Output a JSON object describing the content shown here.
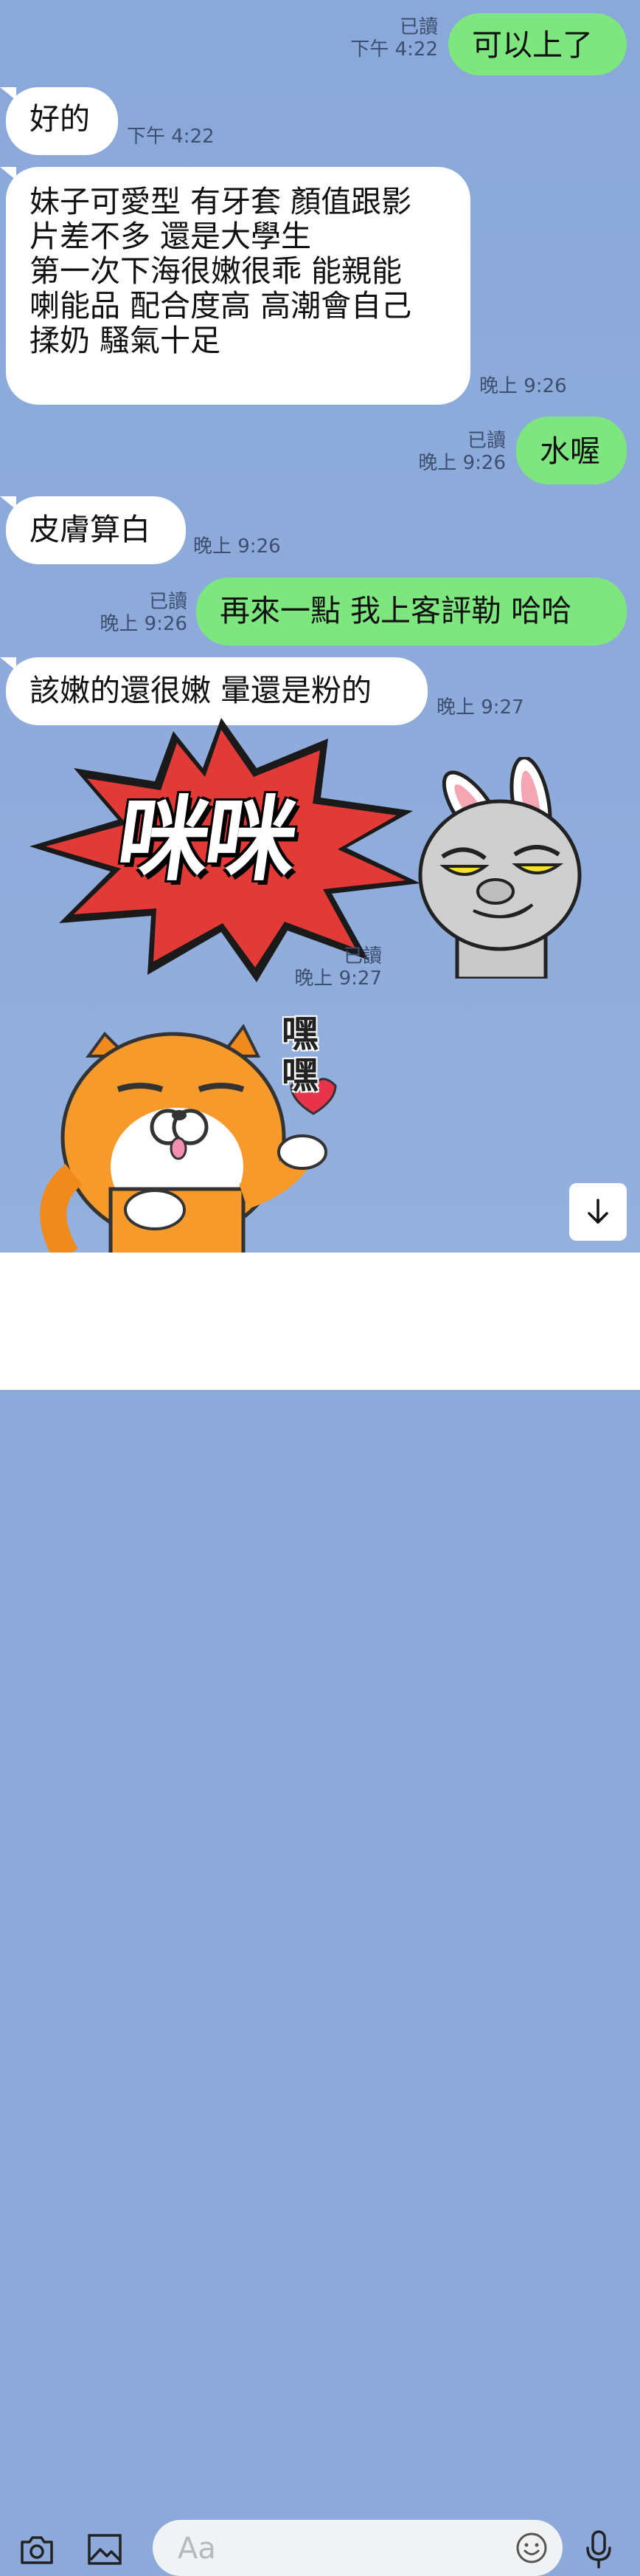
{
  "messages": [
    {
      "side": "out",
      "text": "可以上了",
      "read": "已讀",
      "time": "下午 4:22"
    },
    {
      "side": "in",
      "text": "好的",
      "time": "下午 4:22"
    },
    {
      "side": "in",
      "text": "妹子可愛型 有牙套 顏值跟影\n片差不多 還是大學生\n第一次下海很嫩很乖 能親能\n喇能品 配合度高 高潮會自己\n揉奶 騷氣十足",
      "time": "晚上 9:26"
    },
    {
      "side": "out",
      "text": "水喔",
      "read": "已讀",
      "time": "晚上 9:26"
    },
    {
      "side": "in",
      "text": "皮膚算白",
      "time": "晚上 9:26"
    },
    {
      "side": "out",
      "text": "再來一點 我上客評勒 哈哈",
      "read": "已讀",
      "time": "晚上 9:26"
    },
    {
      "side": "in",
      "text": "該嫩的還很嫩 暈還是粉的",
      "time": "晚上 9:27"
    }
  ],
  "sticker1": {
    "text": "咪咪",
    "read": "已讀",
    "time": "晚上 9:27",
    "icon": "brown-bunny-smirk-icon"
  },
  "sticker2": {
    "text": "嘿嘿",
    "icon": "white-cat-pointing-icon"
  },
  "input": {
    "placeholder": "Aa"
  },
  "colors": {
    "background": "#8ca9d9",
    "outgoing": "#7ee67e",
    "incoming": "#ffffff",
    "burst": "#e23a36"
  }
}
